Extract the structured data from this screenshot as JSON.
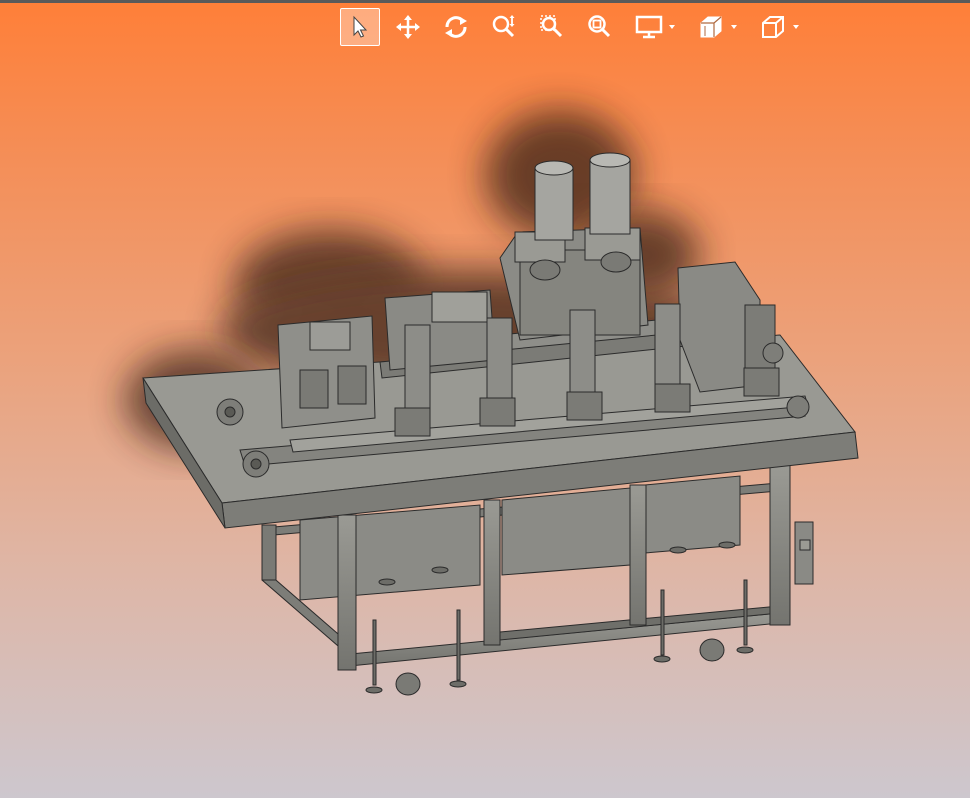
{
  "toolbar": {
    "tools": [
      {
        "icon": "select-arrow-icon",
        "active": true
      },
      {
        "icon": "pan-icon",
        "active": false
      },
      {
        "icon": "rotate-icon",
        "active": false
      },
      {
        "icon": "zoom-in-out-icon",
        "active": false
      },
      {
        "icon": "zoom-to-area-icon",
        "active": false
      },
      {
        "icon": "zoom-to-fit-icon",
        "active": false
      },
      {
        "icon": "display-style-icon",
        "dropdown": true
      },
      {
        "icon": "section-view-icon",
        "dropdown": true
      },
      {
        "icon": "view-orientation-icon",
        "dropdown": true
      }
    ]
  },
  "colors": {
    "background_top": "#ff7f38",
    "background_bottom": "#cdc7ce",
    "model_gray": "#8a8a84",
    "model_edge": "#2b2b2b",
    "active_tool_border": "#ffffff"
  }
}
